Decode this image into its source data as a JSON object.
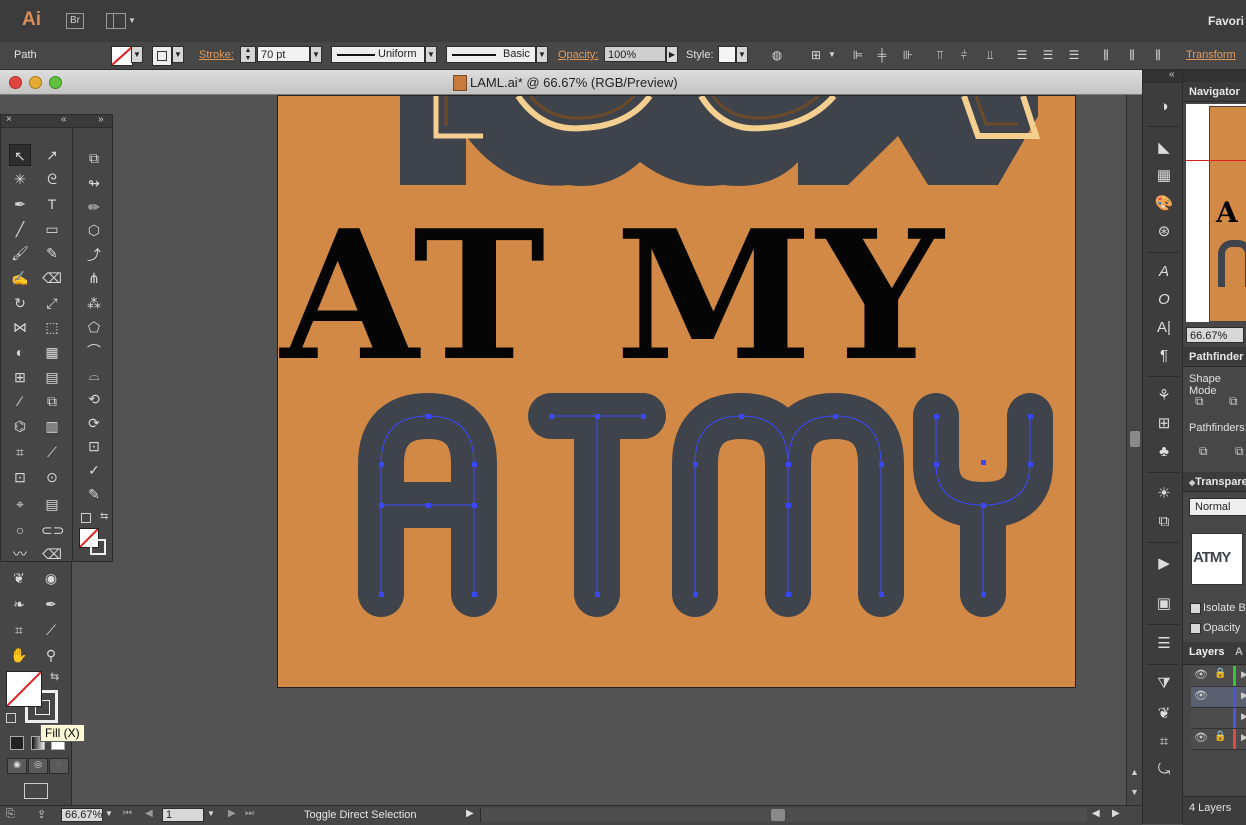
{
  "app": {
    "logo": "Ai",
    "bridge_label": "Br",
    "favorites_label": "Favori"
  },
  "control_bar": {
    "selection_type": "Path",
    "stroke_label": "Stroke:",
    "stroke_weight": "70 pt",
    "profile": "Uniform",
    "brush": "Basic",
    "opacity_label": "Opacity:",
    "opacity_value": "100%",
    "style_label": "Style:",
    "transform_label": "Transform"
  },
  "document": {
    "title": "LAML.ai* @ 66.67% (RGB/Preview)"
  },
  "artwork": {
    "top_word": "LOOK",
    "middle_word": "AT MY",
    "bottom_word": "ATMY",
    "artboard_color": "#d38946",
    "slate_color": "#3f444c",
    "cream_color": "#f5cf8f"
  },
  "tooltip": {
    "text": "Fill (X)"
  },
  "status_bar": {
    "zoom": "66.67%",
    "page": "1",
    "tool_hint": "Toggle Direct Selection"
  },
  "panels": {
    "navigator_title": "Navigator",
    "navigator_zoom": "66.67%",
    "pathfinder_title": "Pathfinder",
    "shape_modes_label": "Shape Mode",
    "pathfinders_label": "Pathfinders:",
    "transparency_title": "Transpare",
    "blend_mode": "Normal",
    "thumb_text": "ATMY",
    "isolate_label": "Isolate B",
    "opacity_mask_label": "Opacity",
    "layers_title": "Layers",
    "layers_tab2": "A",
    "layers_count": "4 Layers"
  }
}
